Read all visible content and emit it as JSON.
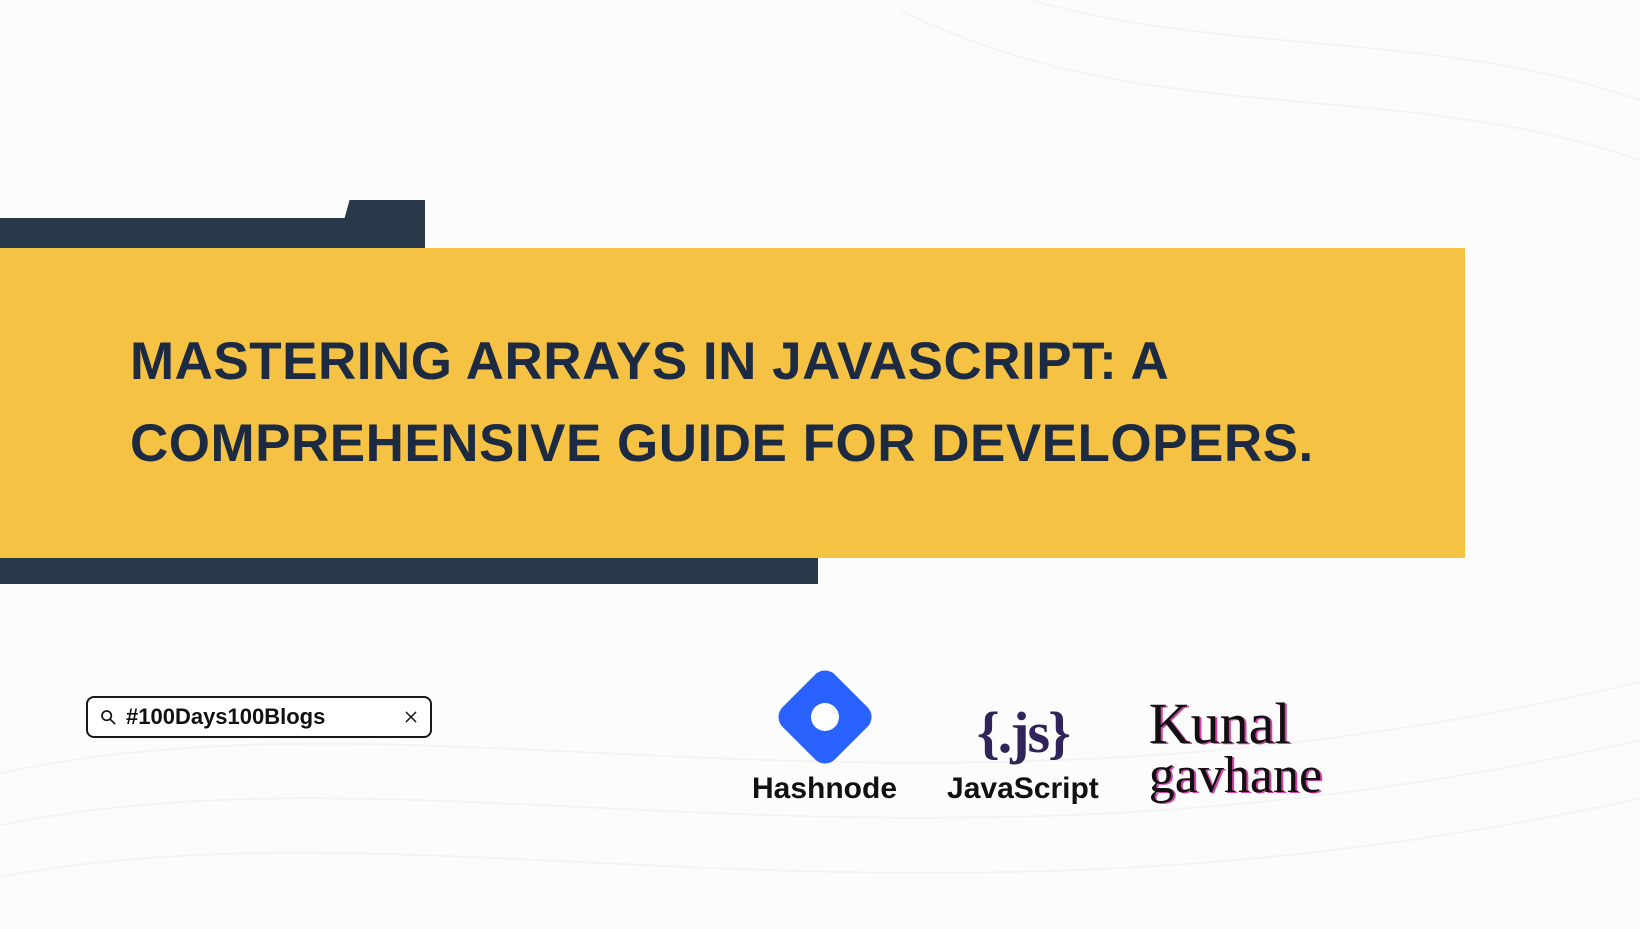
{
  "hero": {
    "title": "MASTERING ARRAYS IN JAVASCRIPT: A COMPREHENSIVE GUIDE FOR DEVELOPERS."
  },
  "search": {
    "value": "#100Days100Blogs"
  },
  "logos": {
    "hashnode_label": "Hashnode",
    "javascript_logo_text": "{.js}",
    "javascript_label": "JavaScript"
  },
  "signature": {
    "first": "Kunal",
    "last": "gavhane"
  },
  "colors": {
    "accent_yellow": "#f5c243",
    "dark_navy": "#28394a",
    "title_navy": "#1d2b42",
    "hashnode_blue": "#2a62ff",
    "js_purple": "#30245a",
    "signature_pink": "#d444a7"
  }
}
